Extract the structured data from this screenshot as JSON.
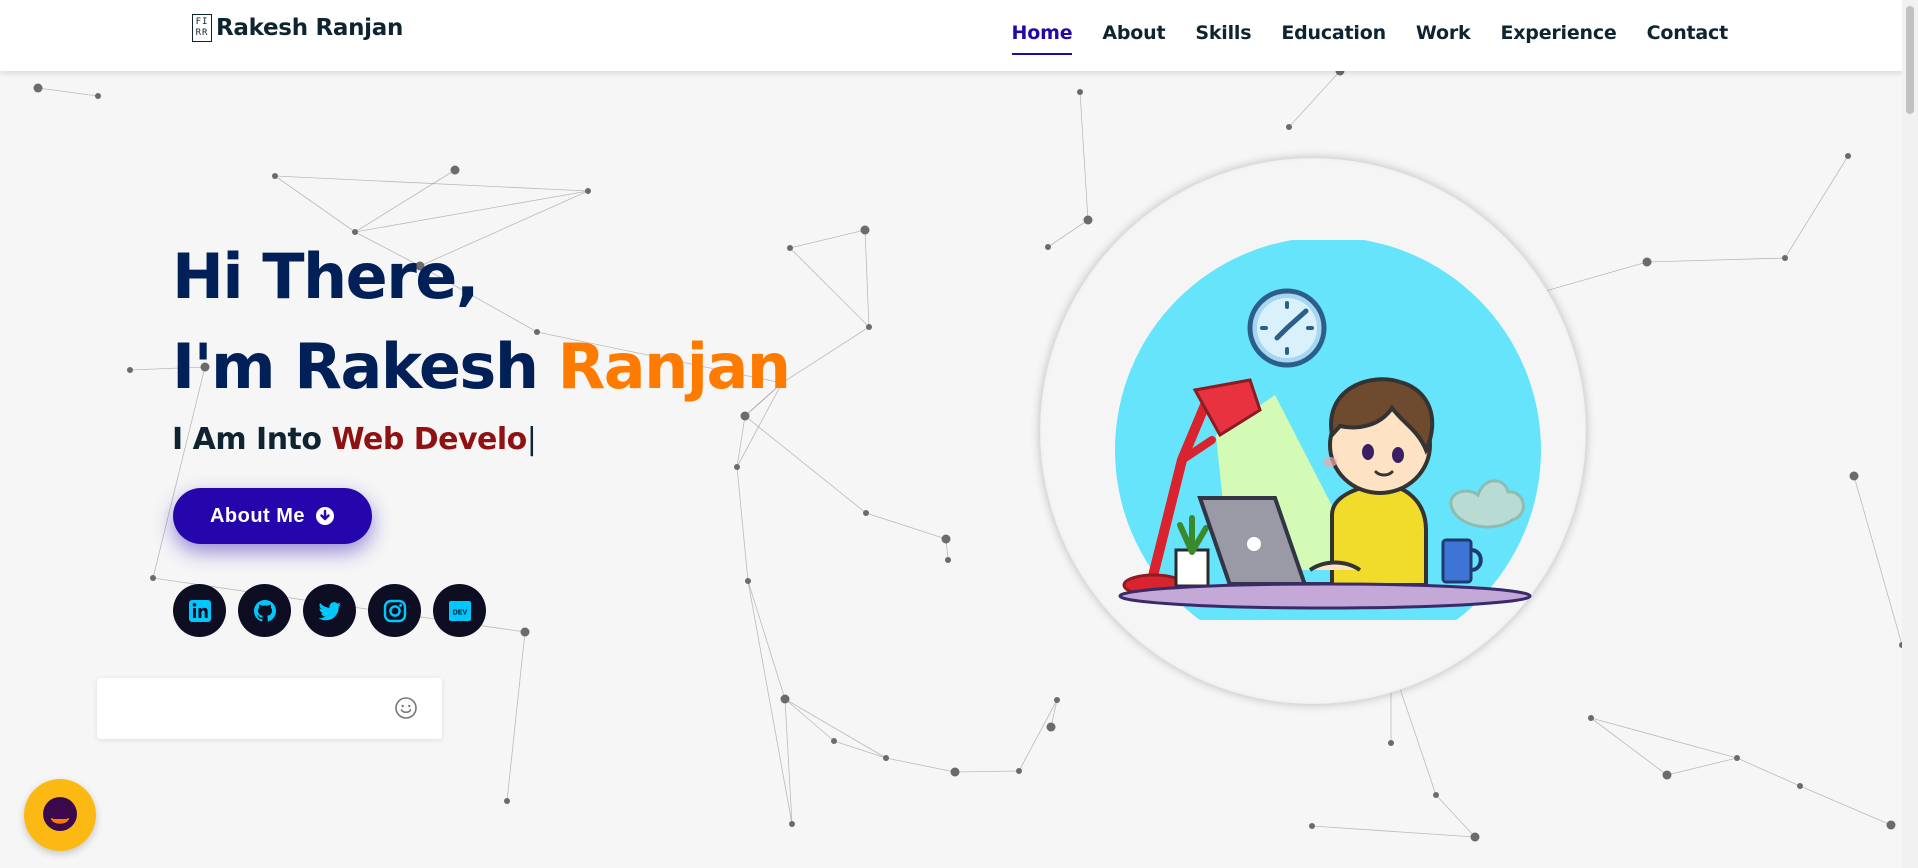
{
  "brand": {
    "name": "Rakesh Ranjan",
    "icon_glyph_top": "FI",
    "icon_glyph_bottom": "RR",
    "icon": "logo-box-icon"
  },
  "nav": {
    "items": [
      {
        "label": "Home",
        "active": true
      },
      {
        "label": "About",
        "active": false
      },
      {
        "label": "Skills",
        "active": false
      },
      {
        "label": "Education",
        "active": false
      },
      {
        "label": "Work",
        "active": false
      },
      {
        "label": "Experience",
        "active": false
      },
      {
        "label": "Contact",
        "active": false
      }
    ]
  },
  "hero": {
    "greeting": "Hi There,",
    "intro_prefix": "I'm Rakesh ",
    "intro_accent": "Ranjan",
    "typed_prefix": "I Am Into ",
    "typed_role": "Web Develo",
    "caret": "|",
    "button_label": "About Me",
    "button_icon": "arrow-down-circle-icon"
  },
  "socials": [
    {
      "name": "linkedin",
      "icon": "linkedin-icon"
    },
    {
      "name": "github",
      "icon": "github-icon"
    },
    {
      "name": "twitter",
      "icon": "twitter-icon"
    },
    {
      "name": "instagram",
      "icon": "instagram-icon"
    },
    {
      "name": "dev",
      "icon": "dev-icon",
      "text": "DEV"
    }
  ],
  "chat": {
    "input_value": "",
    "emoji_icon": "smiley-icon",
    "launcher_icon": "chat-launcher-icon"
  },
  "colors": {
    "primary": "#2506ad",
    "heading": "#002057",
    "accent": "#ff7b00",
    "role": "#8f1111",
    "social_bg": "#0e0e22",
    "social_icon": "#00c8ff",
    "chat_launcher": "#fdb913",
    "background": "#f6f6f6"
  }
}
